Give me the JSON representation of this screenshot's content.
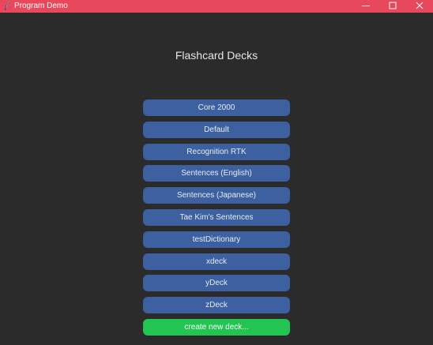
{
  "window": {
    "title": "Program Demo",
    "title_bar_color": "#e8485c",
    "app_icon": "feather-icon",
    "controls": {
      "minimize_icon": "minimize-icon",
      "maximize_icon": "maximize-icon",
      "close_icon": "close-icon"
    }
  },
  "main": {
    "heading": "Flashcard Decks",
    "decks": [
      {
        "label": "Core 2000"
      },
      {
        "label": "Default"
      },
      {
        "label": "Recognition RTK"
      },
      {
        "label": "Sentences (English)"
      },
      {
        "label": "Sentences (Japanese)"
      },
      {
        "label": "Tae Kim's Sentences"
      },
      {
        "label": "testDictionary"
      },
      {
        "label": "xdeck"
      },
      {
        "label": "yDeck"
      },
      {
        "label": "zDeck"
      }
    ],
    "create_button": {
      "label": "create new deck..."
    }
  },
  "colors": {
    "background": "#2b2b2b",
    "deck_button": "#3c60a0",
    "create_button": "#23c552",
    "heading_text": "#e6e6e6"
  }
}
